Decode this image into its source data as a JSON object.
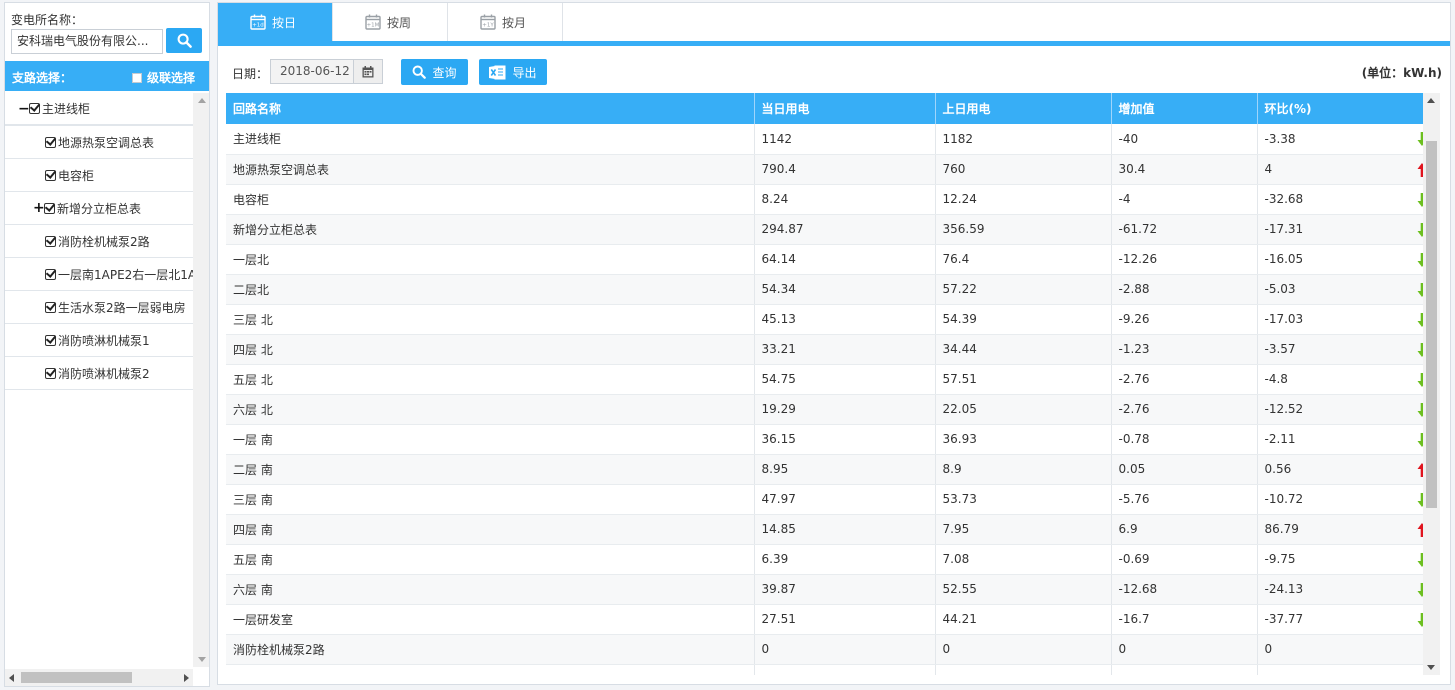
{
  "sidebar": {
    "station_label": "变电所名称：",
    "station_value": "安科瑞电气股份有限公...",
    "branch_title": "支路选择：",
    "cascade_label": "级联选择",
    "tree": [
      {
        "label": "主进线柜",
        "expander": "−",
        "level": 0
      },
      {
        "label": "地源热泵空调总表",
        "expander": "",
        "level": 1
      },
      {
        "label": "电容柜",
        "expander": "",
        "level": 1
      },
      {
        "label": "新增分立柜总表",
        "expander": "+",
        "level": 1
      },
      {
        "label": "消防栓机械泵2路",
        "expander": "",
        "level": 1
      },
      {
        "label": "一层南1APE2右一层北1A",
        "expander": "",
        "level": 1
      },
      {
        "label": "生活水泵2路一层弱电房",
        "expander": "",
        "level": 1
      },
      {
        "label": "消防喷淋机械泵1",
        "expander": "",
        "level": 1
      },
      {
        "label": "消防喷淋机械泵2",
        "expander": "",
        "level": 1
      }
    ]
  },
  "tabs": [
    {
      "label": "按日",
      "icon": "+1d",
      "active": true
    },
    {
      "label": "按周",
      "icon": "+1M",
      "active": false
    },
    {
      "label": "按月",
      "icon": "+1Y",
      "active": false
    }
  ],
  "toolbar": {
    "date_label": "日期：",
    "date_value": "2018-06-12",
    "query_label": "查询",
    "export_label": "导出",
    "unit_label": "(单位：kW.h)"
  },
  "colors": {
    "accent": "#37aef6",
    "down": "#6cbf1f",
    "up": "#e0141e"
  },
  "table": {
    "headers": [
      "回路名称",
      "当日用电",
      "上日用电",
      "增加值",
      "环比(%)"
    ],
    "rows": [
      {
        "name": "主进线柜",
        "today": "1142",
        "yesterday": "1182",
        "diff": "-40",
        "ratio": "-3.38",
        "trend": "down"
      },
      {
        "name": "地源热泵空调总表",
        "today": "790.4",
        "yesterday": "760",
        "diff": "30.4",
        "ratio": "4",
        "trend": "up"
      },
      {
        "name": "电容柜",
        "today": "8.24",
        "yesterday": "12.24",
        "diff": "-4",
        "ratio": "-32.68",
        "trend": "down"
      },
      {
        "name": "新增分立柜总表",
        "today": "294.87",
        "yesterday": "356.59",
        "diff": "-61.72",
        "ratio": "-17.31",
        "trend": "down"
      },
      {
        "name": "一层北",
        "today": "64.14",
        "yesterday": "76.4",
        "diff": "-12.26",
        "ratio": "-16.05",
        "trend": "down"
      },
      {
        "name": "二层北",
        "today": "54.34",
        "yesterday": "57.22",
        "diff": "-2.88",
        "ratio": "-5.03",
        "trend": "down"
      },
      {
        "name": "三层 北",
        "today": "45.13",
        "yesterday": "54.39",
        "diff": "-9.26",
        "ratio": "-17.03",
        "trend": "down"
      },
      {
        "name": "四层 北",
        "today": "33.21",
        "yesterday": "34.44",
        "diff": "-1.23",
        "ratio": "-3.57",
        "trend": "down"
      },
      {
        "name": "五层 北",
        "today": "54.75",
        "yesterday": "57.51",
        "diff": "-2.76",
        "ratio": "-4.8",
        "trend": "down"
      },
      {
        "name": "六层 北",
        "today": "19.29",
        "yesterday": "22.05",
        "diff": "-2.76",
        "ratio": "-12.52",
        "trend": "down"
      },
      {
        "name": "一层 南",
        "today": "36.15",
        "yesterday": "36.93",
        "diff": "-0.78",
        "ratio": "-2.11",
        "trend": "down"
      },
      {
        "name": "二层 南",
        "today": "8.95",
        "yesterday": "8.9",
        "diff": "0.05",
        "ratio": "0.56",
        "trend": "up"
      },
      {
        "name": "三层 南",
        "today": "47.97",
        "yesterday": "53.73",
        "diff": "-5.76",
        "ratio": "-10.72",
        "trend": "down"
      },
      {
        "name": "四层 南",
        "today": "14.85",
        "yesterday": "7.95",
        "diff": "6.9",
        "ratio": "86.79",
        "trend": "up"
      },
      {
        "name": "五层 南",
        "today": "6.39",
        "yesterday": "7.08",
        "diff": "-0.69",
        "ratio": "-9.75",
        "trend": "down"
      },
      {
        "name": "六层 南",
        "today": "39.87",
        "yesterday": "52.55",
        "diff": "-12.68",
        "ratio": "-24.13",
        "trend": "down"
      },
      {
        "name": "一层研发室",
        "today": "27.51",
        "yesterday": "44.21",
        "diff": "-16.7",
        "ratio": "-37.77",
        "trend": "down"
      },
      {
        "name": "消防栓机械泵2路",
        "today": "0",
        "yesterday": "0",
        "diff": "0",
        "ratio": "0",
        "trend": "none"
      },
      {
        "name": "",
        "today": "",
        "yesterday": "",
        "diff": "",
        "ratio": "",
        "trend": "none"
      }
    ]
  }
}
